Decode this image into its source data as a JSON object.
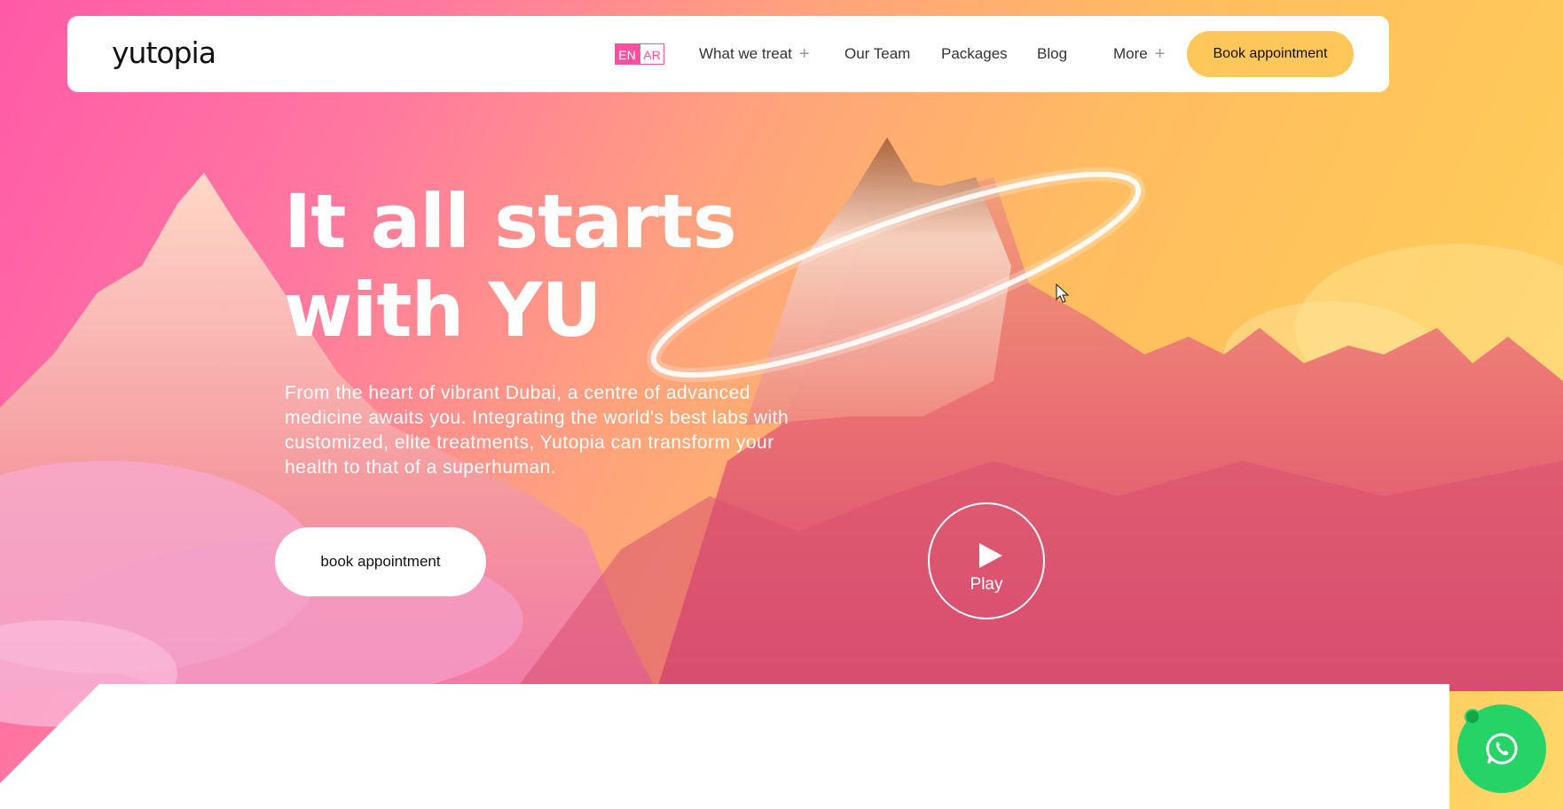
{
  "brand": {
    "logo_text": "yutopia"
  },
  "nav": {
    "lang_en": "EN",
    "lang_ar": "AR",
    "items": [
      {
        "label": "What we treat",
        "has_submenu": true
      },
      {
        "label": "Our Team",
        "has_submenu": false
      },
      {
        "label": "Packages",
        "has_submenu": false
      },
      {
        "label": "Blog",
        "has_submenu": false
      },
      {
        "label": "More",
        "has_submenu": true
      }
    ],
    "submenu_icon": "+",
    "book_label": "Book appointment"
  },
  "hero": {
    "headline_line1": "It all starts",
    "headline_line2": "with YU",
    "paragraph": "From the heart of vibrant Dubai, a centre of advanced medicine awaits you. Integrating the world's best labs with customized, elite treatments, Yutopia can transform your health to that of a superhuman.",
    "cta_label": "book appointment",
    "play_label": "Play"
  },
  "colors": {
    "accent_pink": "#ff4fa0",
    "accent_yellow": "#ffc65a",
    "whatsapp_green": "#25d366"
  },
  "icons": {
    "play": "play-icon",
    "whatsapp": "whatsapp-icon",
    "plus": "plus-icon",
    "cursor": "mouse-cursor-icon"
  }
}
